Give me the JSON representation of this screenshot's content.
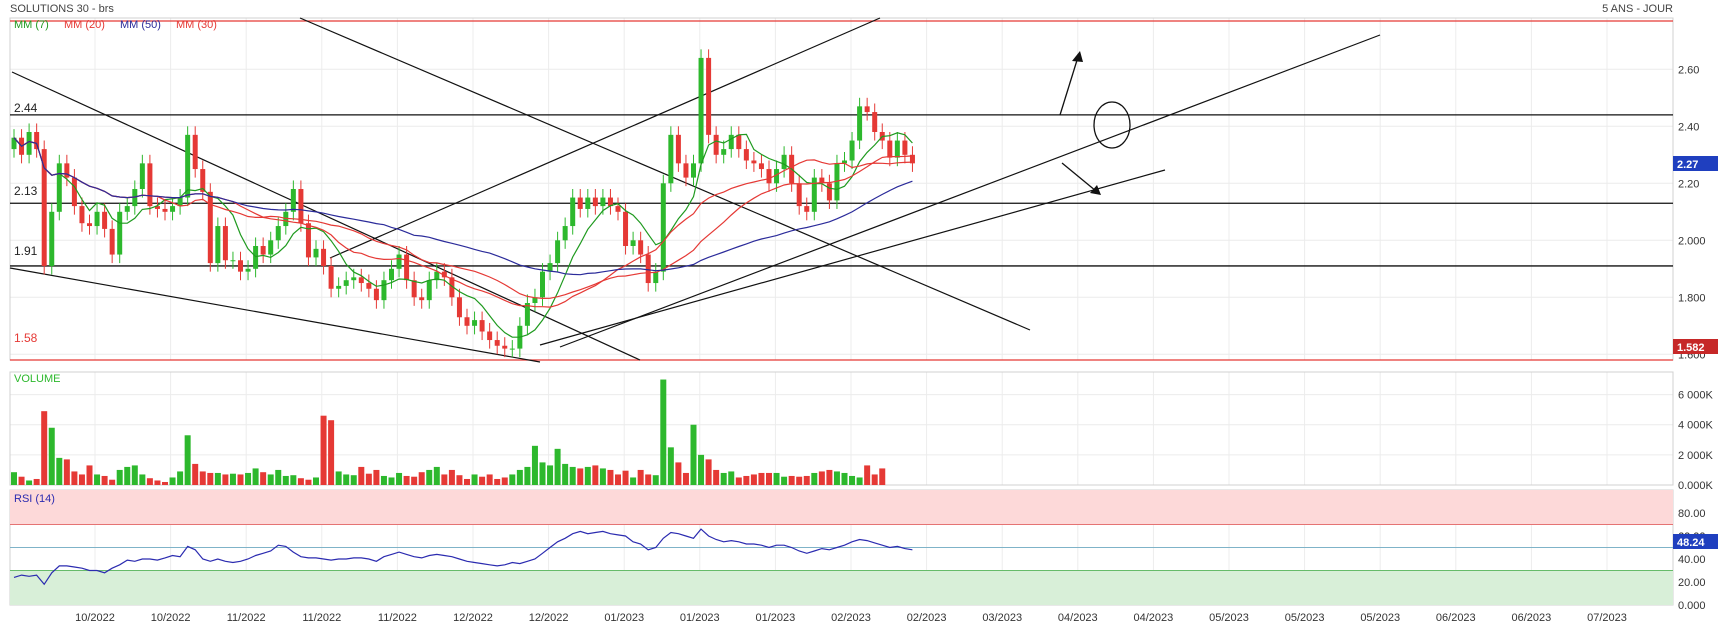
{
  "header": {
    "title": "SOLUTIONS 30 - brs",
    "period": "5 ANS - JOUR"
  },
  "price_panel": {
    "legend": [
      {
        "label": "MM (7)",
        "color": "#1f9a1f"
      },
      {
        "label": "MM (20)",
        "color": "#e53935"
      },
      {
        "label": "MM (50)",
        "color": "#2b2b9a"
      },
      {
        "label": "MM (30)",
        "color": "#e53935"
      }
    ],
    "last_price": "2.27",
    "support_badge": "1.582",
    "level_labels": [
      {
        "label": "2.44",
        "value": 2.44
      },
      {
        "label": "2.13",
        "value": 2.13
      },
      {
        "label": "1.91",
        "value": 1.91
      },
      {
        "label": "1.58",
        "value": 1.58
      }
    ]
  },
  "volume_panel": {
    "label": "VOLUME"
  },
  "rsi_panel": {
    "label": "RSI (14)",
    "last_value": "48.24"
  },
  "colors": {
    "up": "#2db82d",
    "down": "#e53935",
    "rsi_line": "#2b2bb0",
    "overbought_bg": "#fdd9d9",
    "oversold_bg": "#d8efd8",
    "badge_blue": "#1f3fbf",
    "badge_red": "#c62828",
    "red_line": "#e53935"
  },
  "chart_data": [
    {
      "type": "candlestick",
      "panel": "price",
      "ylim": [
        1.58,
        2.78
      ],
      "y_ticks": [
        "1.600",
        "1.800",
        "2.000",
        "2.20",
        "2.40",
        "2.60"
      ],
      "x_ticks": [
        "10/2022",
        "10/2022",
        "11/2022",
        "11/2022",
        "11/2022",
        "12/2022",
        "12/2022",
        "01/2023",
        "01/2023",
        "01/2023",
        "02/2023",
        "02/2023",
        "03/2023",
        "04/2023",
        "04/2023",
        "05/2023",
        "05/2023",
        "05/2023",
        "06/2023",
        "06/2023",
        "07/2023"
      ],
      "close": [
        2.36,
        2.3,
        2.38,
        2.32,
        1.91,
        2.1,
        2.27,
        2.22,
        2.12,
        2.06,
        2.05,
        2.1,
        2.04,
        1.95,
        2.1,
        2.12,
        2.18,
        2.27,
        2.12,
        2.11,
        2.1,
        2.12,
        2.15,
        2.37,
        2.25,
        2.17,
        1.92,
        2.05,
        1.93,
        1.93,
        1.89,
        1.9,
        1.98,
        1.95,
        2.0,
        2.05,
        2.1,
        2.18,
        2.06,
        1.94,
        1.97,
        1.91,
        1.83,
        1.84,
        1.86,
        1.87,
        1.85,
        1.83,
        1.79,
        1.86,
        1.9,
        1.95,
        1.86,
        1.8,
        1.79,
        1.86,
        1.89,
        1.87,
        1.8,
        1.73,
        1.7,
        1.72,
        1.68,
        1.65,
        1.63,
        1.62,
        1.62,
        1.7,
        1.78,
        1.8,
        1.89,
        1.92,
        2.0,
        2.05,
        2.15,
        2.11,
        2.15,
        2.12,
        2.15,
        2.12,
        2.1,
        1.98,
        2.0,
        1.95,
        1.85,
        1.89,
        2.2,
        2.37,
        2.27,
        2.22,
        2.27,
        2.64,
        2.37,
        2.3,
        2.32,
        2.37,
        2.32,
        2.28,
        2.27,
        2.25,
        2.2,
        2.25,
        2.3,
        2.2,
        2.12,
        2.1,
        2.22,
        2.2,
        2.14,
        2.27,
        2.28,
        2.35,
        2.47,
        2.45,
        2.38,
        2.35,
        2.29,
        2.35,
        2.3,
        2.27
      ],
      "volume": [
        850000,
        550000,
        300000,
        400000,
        4900000,
        3800000,
        1800000,
        1700000,
        900000,
        700000,
        1300000,
        700000,
        600000,
        350000,
        1000000,
        1200000,
        1300000,
        700000,
        450000,
        300000,
        200000,
        500000,
        900000,
        3300000,
        1400000,
        900000,
        800000,
        800000,
        700000,
        750000,
        700000,
        800000,
        1100000,
        850000,
        700000,
        1000000,
        600000,
        650000,
        450000,
        350000,
        500000,
        4600000,
        4300000,
        900000,
        700000,
        650000,
        1200000,
        750000,
        1000000,
        600000,
        500000,
        800000,
        600000,
        550000,
        850000,
        1000000,
        1200000,
        700000,
        1000000,
        650000,
        400000,
        700000,
        550000,
        700000,
        400000,
        500000,
        700000,
        1000000,
        1200000,
        2600000,
        1500000,
        1300000,
        2400000,
        1400000,
        1200000,
        1100000,
        1200000,
        1300000,
        1100000,
        1000000,
        700000,
        950000,
        500000,
        1000000,
        700000,
        650000,
        7000000,
        2500000,
        1500000,
        800000,
        4000000,
        2000000,
        1700000,
        1000000,
        800000,
        900000,
        500000,
        600000,
        700000,
        800000,
        800000,
        800000,
        550000,
        600000,
        550000,
        600000,
        800000,
        900000,
        1000000,
        900000,
        800000,
        600000,
        500000,
        1300000,
        700000,
        1100000
      ]
    },
    {
      "type": "line",
      "panel": "rsi",
      "title": "RSI (14)",
      "ylim": [
        0,
        100
      ],
      "y_ticks": [
        "0.000",
        "20.00",
        "40.00",
        "60.00",
        "80.00"
      ],
      "bands": {
        "overbought": 70,
        "oversold": 30,
        "mid": 50
      },
      "values": [
        24,
        26,
        25,
        26,
        18,
        28,
        34,
        34,
        33,
        32,
        30,
        30,
        28,
        32,
        35,
        39,
        38,
        40,
        40,
        39,
        41,
        43,
        42,
        51,
        48,
        40,
        38,
        40,
        38,
        37,
        38,
        40,
        43,
        45,
        47,
        52,
        51,
        46,
        42,
        41,
        41,
        40,
        39,
        40,
        40,
        41,
        41,
        40,
        38,
        42,
        44,
        46,
        44,
        42,
        41,
        43,
        44,
        43,
        42,
        40,
        38,
        37,
        36,
        35,
        34,
        35,
        37,
        36,
        38,
        40,
        45,
        50,
        55,
        58,
        62,
        64,
        62,
        63,
        64,
        62,
        61,
        60,
        55,
        53,
        48,
        50,
        58,
        63,
        62,
        60,
        58,
        66,
        60,
        57,
        55,
        56,
        55,
        53,
        53,
        52,
        50,
        52,
        52,
        50,
        47,
        45,
        47,
        49,
        48,
        50,
        52,
        55,
        57,
        56,
        54,
        52,
        50,
        51,
        49,
        48
      ]
    }
  ]
}
